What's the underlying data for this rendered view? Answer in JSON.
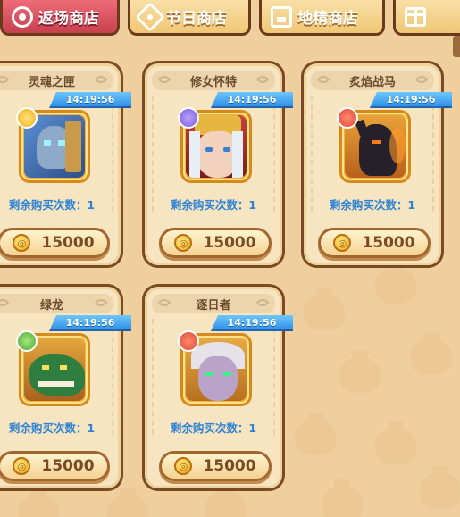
{
  "tabs": [
    {
      "label": "返场商店",
      "icon": "return-icon",
      "active": true
    },
    {
      "label": "节日商店",
      "icon": "festival-icon",
      "active": false
    },
    {
      "label": "地精商店",
      "icon": "shop-icon",
      "active": false
    },
    {
      "label": "",
      "icon": "gift-icon",
      "active": false
    }
  ],
  "items": [
    {
      "name": "灵魂之匣",
      "timer": "14:19:56",
      "remaining": "剩余购买次数：1",
      "price": "15000",
      "element": "holy",
      "portrait_color": "#3b6fb4"
    },
    {
      "name": "修女怀特",
      "timer": "14:19:56",
      "remaining": "剩余购买次数：1",
      "price": "15000",
      "element": "arcane",
      "portrait_color": "#9b2f2a"
    },
    {
      "name": "炙焰战马",
      "timer": "14:19:56",
      "remaining": "剩余购买次数：1",
      "price": "15000",
      "element": "fire",
      "portrait_color": "#2a2430"
    },
    {
      "name": "绿龙",
      "timer": "14:19:56",
      "remaining": "剩余购买次数：1",
      "price": "15000",
      "element": "nature",
      "portrait_color": "#2f7d3f"
    },
    {
      "name": "逐日者",
      "timer": "14:19:56",
      "remaining": "剩余购买次数：1",
      "price": "15000",
      "element": "fire",
      "portrait_color": "#6a4a8a"
    }
  ],
  "colors": {
    "background": "#efcf9e",
    "active_tab": "#d94a58",
    "timer": "#3192e6",
    "remaining_text": "#2d82d4",
    "element_fire": "#e0463a",
    "element_holy": "#f0b020",
    "element_arcane": "#7c5ad8",
    "element_nature": "#4da83e"
  }
}
